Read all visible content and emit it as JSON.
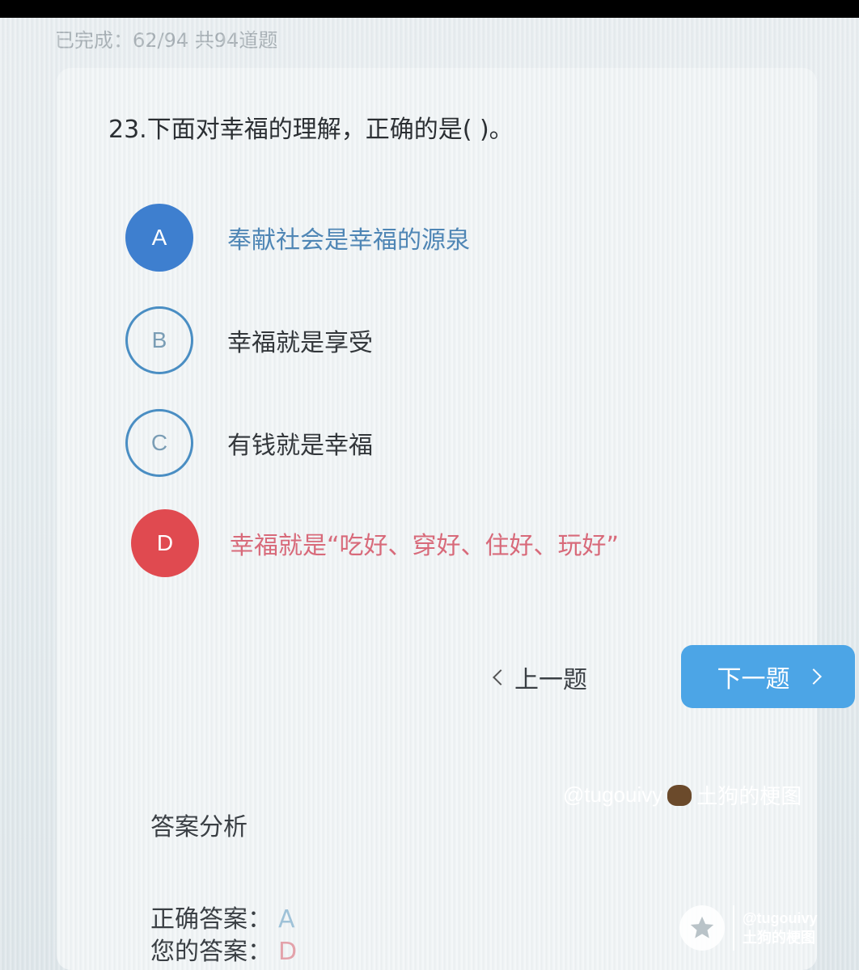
{
  "progress": "已完成：62/94 共94道题",
  "question": "23.下面对幸福的理解，正确的是( )。",
  "options": [
    {
      "letter": "A",
      "text": "奉献社会是幸福的源泉"
    },
    {
      "letter": "B",
      "text": "幸福就是享受"
    },
    {
      "letter": "C",
      "text": "有钱就是幸福"
    },
    {
      "letter": "D",
      "text": "幸福就是“吃好、穿好、住好、玩好”"
    }
  ],
  "nav": {
    "prev_label": "上一题",
    "next_label": "下一题"
  },
  "analysis": {
    "title": "答案分析",
    "correct_label": "正确答案：",
    "correct_value": "A",
    "yours_label": "您的答案：",
    "yours_value": "D"
  },
  "watermark": {
    "handle": "@tugouivy",
    "name": "土狗的梗图"
  },
  "colors": {
    "correct": "#3e7fcf",
    "wrong": "#e04a50",
    "accent": "#4ca5e6",
    "outline": "#4a8ec3"
  },
  "icons": [
    "chevron-left-icon",
    "chevron-right-icon",
    "dog-emoji-icon",
    "star-icon"
  ]
}
